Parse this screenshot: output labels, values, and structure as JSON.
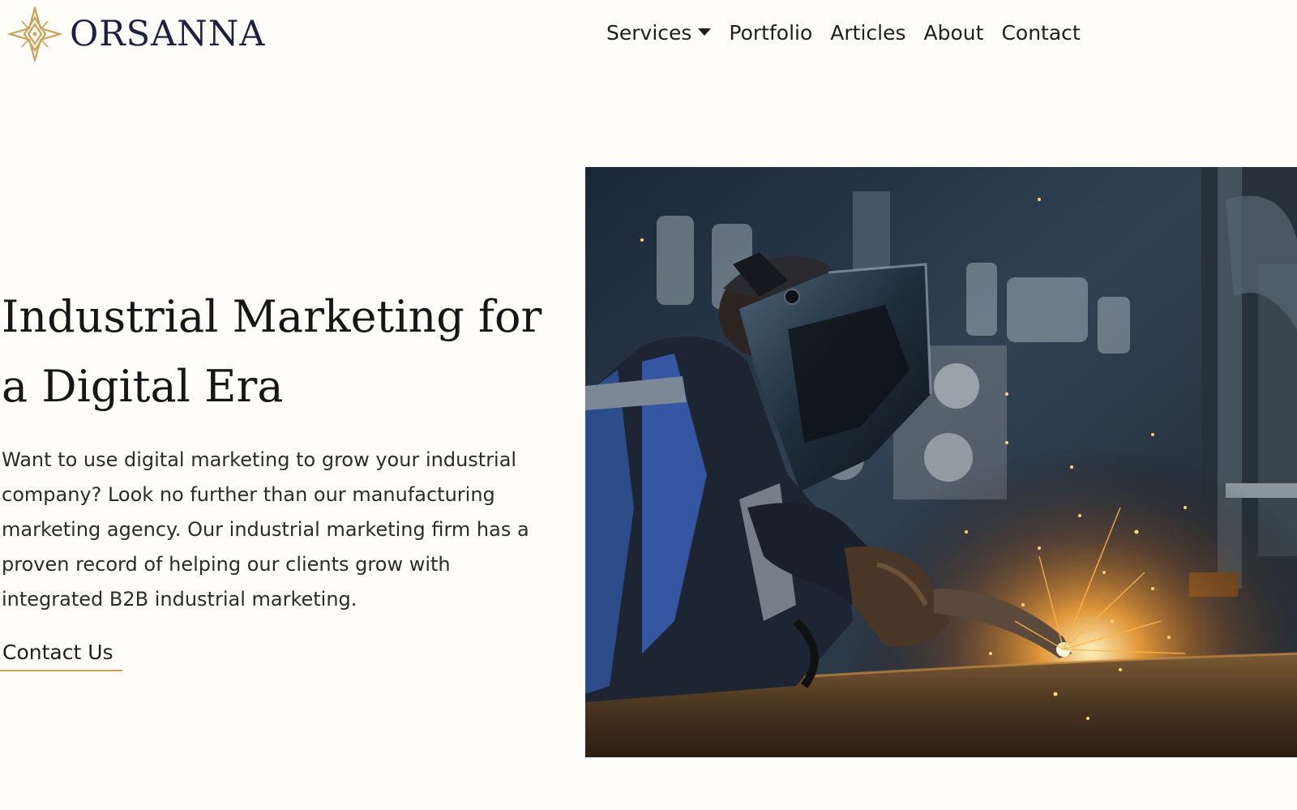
{
  "brand": {
    "name": "ORSANNA",
    "accent_color": "#c9a256",
    "text_color": "#1d2140"
  },
  "nav": {
    "items": [
      {
        "label": "Services",
        "has_dropdown": true
      },
      {
        "label": "Portfolio"
      },
      {
        "label": "Articles"
      },
      {
        "label": "About"
      },
      {
        "label": "Contact"
      }
    ]
  },
  "hero": {
    "title": "Industrial Marketing for a Digital Era",
    "description": "Want to use digital marketing to grow your industrial company? Look no further than our manufacturing marketing agency. Our industrial marketing firm has a proven record of helping our clients grow with integrated B2B industrial marketing.",
    "cta_label": "Contact Us",
    "image_subject": "welder in protective mask welding metal with sparks"
  }
}
